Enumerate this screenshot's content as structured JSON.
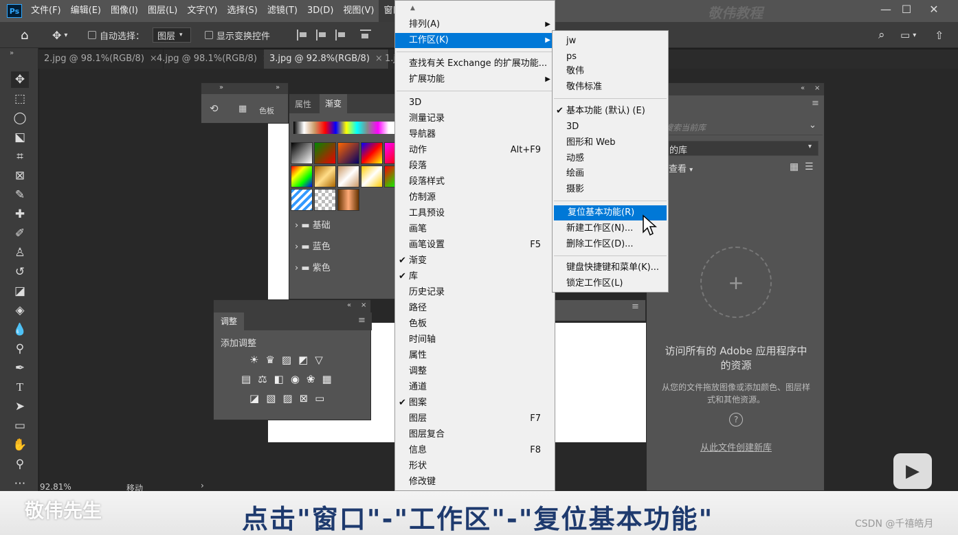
{
  "app": {
    "logo": "Ps",
    "watermark": "敬伟教程"
  },
  "menubar": {
    "items": [
      "文件(F)",
      "编辑(E)",
      "图像(I)",
      "图层(L)",
      "文字(Y)",
      "选择(S)",
      "滤镜(T)",
      "3D(D)",
      "视图(V)",
      "窗口(W)"
    ],
    "active": "窗口(W)"
  },
  "window_controls": {
    "minimize": "—",
    "maximize": "☐",
    "close": "✕"
  },
  "options_bar": {
    "auto_select_label": "自动选择：",
    "layer_select_value": "图层",
    "show_transform_label": "显示变换控件"
  },
  "doc_tabs": [
    {
      "label": "2.jpg @ 98.1%(RGB/8)",
      "close": "×",
      "active": false
    },
    {
      "label": "4.jpg @ 98.1%(RGB/8)",
      "close": "×",
      "active": false
    },
    {
      "label": "3.jpg @ 92.8%(RGB/8)",
      "close": "×",
      "active": true
    },
    {
      "label": "1.j",
      "close": "",
      "active": false
    }
  ],
  "swatch_panel": {
    "tab_color": "色板"
  },
  "gradient_panel": {
    "tab_props": "属性",
    "tab_gradient": "渐变",
    "folders": [
      "基础",
      "蓝色",
      "紫色"
    ]
  },
  "adjust_panel": {
    "tab": "调整",
    "add_label": "添加调整"
  },
  "window_menu": {
    "items": [
      {
        "label": "排列(A)",
        "arrow": "▶"
      },
      {
        "label": "工作区(K)",
        "arrow": "▶",
        "hl": true
      },
      {
        "label": "查找有关 Exchange 的扩展功能..."
      },
      {
        "label": "扩展功能",
        "arrow": "▶"
      },
      {
        "label": "3D"
      },
      {
        "label": "测量记录"
      },
      {
        "label": "导航器"
      },
      {
        "label": "动作",
        "shortcut": "Alt+F9"
      },
      {
        "label": "段落"
      },
      {
        "label": "段落样式"
      },
      {
        "label": "仿制源"
      },
      {
        "label": "工具预设"
      },
      {
        "label": "画笔"
      },
      {
        "label": "画笔设置",
        "shortcut": "F5"
      },
      {
        "label": "渐变",
        "check": "✔"
      },
      {
        "label": "库",
        "check": "✔"
      },
      {
        "label": "历史记录"
      },
      {
        "label": "路径"
      },
      {
        "label": "色板"
      },
      {
        "label": "时间轴"
      },
      {
        "label": "属性"
      },
      {
        "label": "调整"
      },
      {
        "label": "通道"
      },
      {
        "label": "图案",
        "check": "✔"
      },
      {
        "label": "图层",
        "shortcut": "F7"
      },
      {
        "label": "图层复合"
      },
      {
        "label": "信息",
        "shortcut": "F8"
      },
      {
        "label": "形状"
      },
      {
        "label": "修改键"
      }
    ]
  },
  "workspace_menu": {
    "items": [
      {
        "label": "jw"
      },
      {
        "label": "ps"
      },
      {
        "label": "敬伟"
      },
      {
        "label": "敬伟标准"
      },
      {
        "label": "基本功能 (默认) (E)",
        "check": "✔"
      },
      {
        "label": "3D"
      },
      {
        "label": "图形和 Web"
      },
      {
        "label": "动感"
      },
      {
        "label": "绘画"
      },
      {
        "label": "摄影"
      },
      {
        "label": "复位基本功能(R)",
        "hl": true
      },
      {
        "label": "新建工作区(N)..."
      },
      {
        "label": "删除工作区(D)..."
      },
      {
        "label": "键盘快捷键和菜单(K)..."
      },
      {
        "label": "锁定工作区(L)"
      }
    ]
  },
  "library_panel": {
    "search_placeholder": "搜索当前库",
    "library_select": "的库",
    "view_label": "查看",
    "plus": "+",
    "headline": "访问所有的 Adobe 应用程序中的资源",
    "desc": "从您的文件拖放图像或添加颜色、图层样式和其他资源。",
    "help": "?",
    "create_link": "从此文件创建新库"
  },
  "status": {
    "zoom": "92.81%",
    "info": "移动"
  },
  "banner": {
    "logo_text": "敬伟先生",
    "caption": "点击\"窗口\"-\"工作区\"-\"复位基本功能\"",
    "credit": "CSDN @千禧皓月"
  }
}
